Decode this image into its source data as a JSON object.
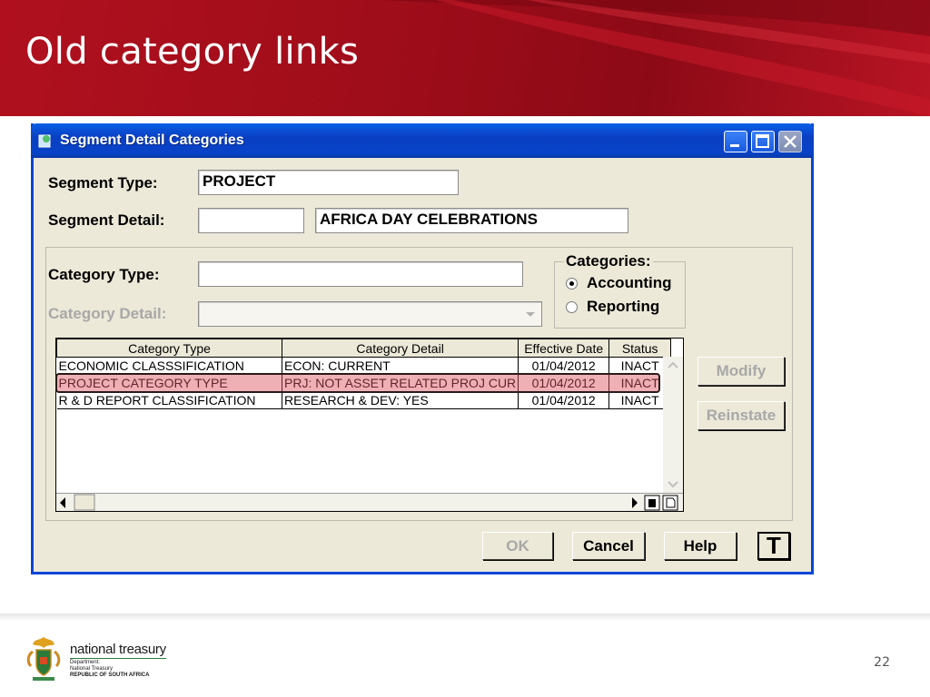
{
  "slide": {
    "title": "Old category links",
    "page_number": "22"
  },
  "dialog": {
    "title": "Segment Detail Categories",
    "segment_type_label": "Segment Type:",
    "segment_type_value": "PROJECT",
    "segment_detail_label": "Segment Detail:",
    "segment_detail_code": "",
    "segment_detail_value": "AFRICA DAY CELEBRATIONS",
    "category_type_label": "Category Type:",
    "category_type_value": "",
    "category_detail_label": "Category Detail:",
    "category_detail_value": "",
    "categories_group_label": "Categories:",
    "radio_accounting": "Accounting",
    "radio_reporting": "Reporting",
    "selected_category": "Accounting",
    "grid": {
      "columns": [
        "Category Type",
        "Category Detail",
        "Effective Date",
        "Status"
      ],
      "rows": [
        [
          "ECONOMIC CLASSSIFICATION",
          "ECON: CURRENT",
          "01/04/2012",
          "INACT"
        ],
        [
          "PROJECT CATEGORY TYPE",
          "PRJ: NOT ASSET RELATED PROJ CUR",
          "01/04/2012",
          "INACT"
        ],
        [
          "R & D REPORT CLASSIFICATION",
          "RESEARCH & DEV: YES",
          "01/04/2012",
          "INACT"
        ]
      ],
      "highlighted_row": 1
    },
    "buttons": {
      "modify": "Modify",
      "reinstate": "Reinstate",
      "ok": "OK",
      "cancel": "Cancel",
      "help": "Help",
      "t": "T"
    }
  },
  "footer": {
    "org_name": "national treasury",
    "line1": "Department:",
    "line2": "National Treasury",
    "line3": "REPUBLIC OF SOUTH AFRICA"
  },
  "colors": {
    "header_red": "#a00d1a",
    "titlebar_blue": "#0a4fd8",
    "window_bg": "#ece9d8",
    "highlight": "#e38a90"
  }
}
